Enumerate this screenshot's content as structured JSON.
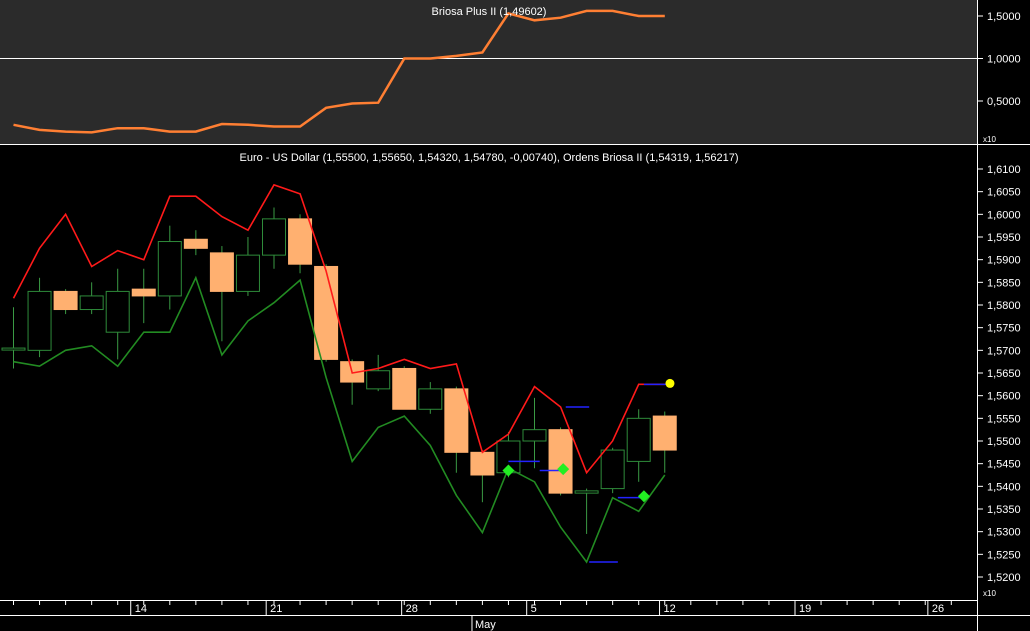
{
  "chart_data": [
    {
      "type": "line",
      "title": "Briosa Plus II (1,49602)",
      "scale_suffix": "x10",
      "ylim": [
        0.1,
        1.7
      ],
      "yticks": [
        0.5,
        1.0,
        1.5
      ],
      "ytick_labels": [
        "0,5000",
        "1,0000",
        "1,5000"
      ],
      "line_color": "#ff7f33",
      "series": [
        {
          "x": [
            0,
            1,
            2,
            3,
            4,
            5,
            6,
            7,
            8,
            9,
            10,
            11,
            12,
            13,
            14,
            15,
            16,
            17,
            18,
            19,
            20,
            21,
            22,
            23,
            24,
            25
          ],
          "values": [
            0.22,
            0.16,
            0.14,
            0.13,
            0.18,
            0.18,
            0.14,
            0.14,
            0.23,
            0.22,
            0.2,
            0.2,
            0.42,
            0.47,
            0.48,
            1.0,
            1.0,
            1.03,
            1.07,
            1.53,
            1.45,
            1.48,
            1.56,
            1.56,
            1.5,
            1.5
          ]
        }
      ]
    },
    {
      "type": "candlestick",
      "title": "Euro - US Dollar (1,55500, 1,55650, 1,54320, 1,54780, -0,00740), Ordens Briosa II (1,54319, 1,56217)",
      "scale_suffix": "x10",
      "ylim": [
        1.5185,
        1.6115
      ],
      "yticks": [
        1.52,
        1.525,
        1.53,
        1.535,
        1.54,
        1.545,
        1.55,
        1.555,
        1.56,
        1.565,
        1.57,
        1.575,
        1.58,
        1.585,
        1.59,
        1.595,
        1.6,
        1.605,
        1.61
      ],
      "ytick_labels": [
        "1,5200",
        "1,5250",
        "1,5300",
        "1,5350",
        "1,5400",
        "1,5450",
        "1,5500",
        "1,5550",
        "1,5600",
        "1,5650",
        "1,5700",
        "1,5750",
        "1,5800",
        "1,5850",
        "1,5900",
        "1,5950",
        "1,6000",
        "1,6050",
        "1,6100"
      ],
      "x_labels": [
        {
          "i": 4.5,
          "label": "14"
        },
        {
          "i": 9.7,
          "label": "21"
        },
        {
          "i": 14.9,
          "label": "28"
        },
        {
          "i": 19.7,
          "label": "5"
        },
        {
          "i": 24.8,
          "label": "12"
        },
        {
          "i": 30.0,
          "label": "19"
        },
        {
          "i": 35.1,
          "label": "26"
        }
      ],
      "month_label": {
        "i": 17.6,
        "label": "May"
      },
      "candles": [
        {
          "o": 1.5705,
          "h": 1.5795,
          "l": 1.566,
          "c": 1.5705
        },
        {
          "o": 1.57,
          "h": 1.586,
          "l": 1.5685,
          "c": 1.583
        },
        {
          "o": 1.583,
          "h": 1.5835,
          "l": 1.578,
          "c": 1.579
        },
        {
          "o": 1.579,
          "h": 1.585,
          "l": 1.578,
          "c": 1.582
        },
        {
          "o": 1.574,
          "h": 1.588,
          "l": 1.568,
          "c": 1.583
        },
        {
          "o": 1.5835,
          "h": 1.588,
          "l": 1.576,
          "c": 1.582
        },
        {
          "o": 1.582,
          "h": 1.5975,
          "l": 1.579,
          "c": 1.594
        },
        {
          "o": 1.5945,
          "h": 1.5965,
          "l": 1.591,
          "c": 1.5925
        },
        {
          "o": 1.5915,
          "h": 1.593,
          "l": 1.572,
          "c": 1.583
        },
        {
          "o": 1.583,
          "h": 1.595,
          "l": 1.582,
          "c": 1.591
        },
        {
          "o": 1.591,
          "h": 1.6015,
          "l": 1.588,
          "c": 1.599
        },
        {
          "o": 1.599,
          "h": 1.6,
          "l": 1.587,
          "c": 1.589
        },
        {
          "o": 1.5885,
          "h": 1.589,
          "l": 1.5675,
          "c": 1.568
        },
        {
          "o": 1.5675,
          "h": 1.568,
          "l": 1.558,
          "c": 1.563
        },
        {
          "o": 1.5615,
          "h": 1.569,
          "l": 1.561,
          "c": 1.5655
        },
        {
          "o": 1.566,
          "h": 1.5665,
          "l": 1.557,
          "c": 1.557
        },
        {
          "o": 1.557,
          "h": 1.563,
          "l": 1.556,
          "c": 1.5615
        },
        {
          "o": 1.5615,
          "h": 1.562,
          "l": 1.543,
          "c": 1.5475
        },
        {
          "o": 1.5475,
          "h": 1.548,
          "l": 1.5365,
          "c": 1.5425
        },
        {
          "o": 1.543,
          "h": 1.552,
          "l": 1.542,
          "c": 1.55
        },
        {
          "o": 1.55,
          "h": 1.5595,
          "l": 1.544,
          "c": 1.5525
        },
        {
          "o": 1.5525,
          "h": 1.553,
          "l": 1.538,
          "c": 1.5385
        },
        {
          "o": 1.5385,
          "h": 1.5395,
          "l": 1.5295,
          "c": 1.539
        },
        {
          "o": 1.5395,
          "h": 1.5485,
          "l": 1.5385,
          "c": 1.548
        },
        {
          "o": 1.5455,
          "h": 1.557,
          "l": 1.541,
          "c": 1.555
        },
        {
          "o": 1.5555,
          "h": 1.5565,
          "l": 1.543,
          "c": 1.548
        }
      ],
      "red_line": [
        1.5815,
        1.5925,
        1.6,
        1.5885,
        1.592,
        1.59,
        1.604,
        1.604,
        1.5995,
        1.5965,
        1.6065,
        1.6045,
        1.5875,
        1.565,
        1.566,
        1.568,
        1.566,
        1.567,
        1.5475,
        1.5515,
        1.562,
        1.5575,
        1.543,
        1.55,
        1.5625,
        1.5625
      ],
      "green_line": [
        1.5675,
        1.5665,
        1.57,
        1.571,
        1.5665,
        1.574,
        1.574,
        1.586,
        1.569,
        1.5765,
        1.5805,
        1.5855,
        1.564,
        1.5455,
        1.553,
        1.5555,
        1.549,
        1.538,
        1.5298,
        1.544,
        1.541,
        1.531,
        1.5233,
        1.5375,
        1.5345,
        1.5425
      ],
      "blue_segments": [
        {
          "i0": 19.0,
          "i1": 20.2,
          "y": 1.5455
        },
        {
          "i0": 20.2,
          "i1": 21.2,
          "y": 1.5435
        },
        {
          "i0": 21.2,
          "i1": 22.1,
          "y": 1.5575
        },
        {
          "i0": 22.1,
          "i1": 23.2,
          "y": 1.5233
        },
        {
          "i0": 23.2,
          "i1": 24.2,
          "y": 1.5375
        },
        {
          "i0": 24.2,
          "i1": 25.2,
          "y": 1.5625
        }
      ],
      "green_diamonds": [
        {
          "i": 19.0,
          "y": 1.5435
        },
        {
          "i": 21.1,
          "y": 1.5438
        },
        {
          "i": 24.2,
          "y": 1.5378
        }
      ],
      "yellow_dot": {
        "i": 25.2,
        "y": 1.5627
      },
      "colors": {
        "bull_body": "#000000",
        "bull_border": "#2e8b3a",
        "bear_body": "#ffb070",
        "bear_border": "#ffb070",
        "wick": "#3a9a44",
        "red_line": "#ff1a1a",
        "green_line": "#228b22",
        "blue": "#2323ff",
        "diamond": "#22ee22",
        "dot": "#ffff00"
      }
    }
  ]
}
